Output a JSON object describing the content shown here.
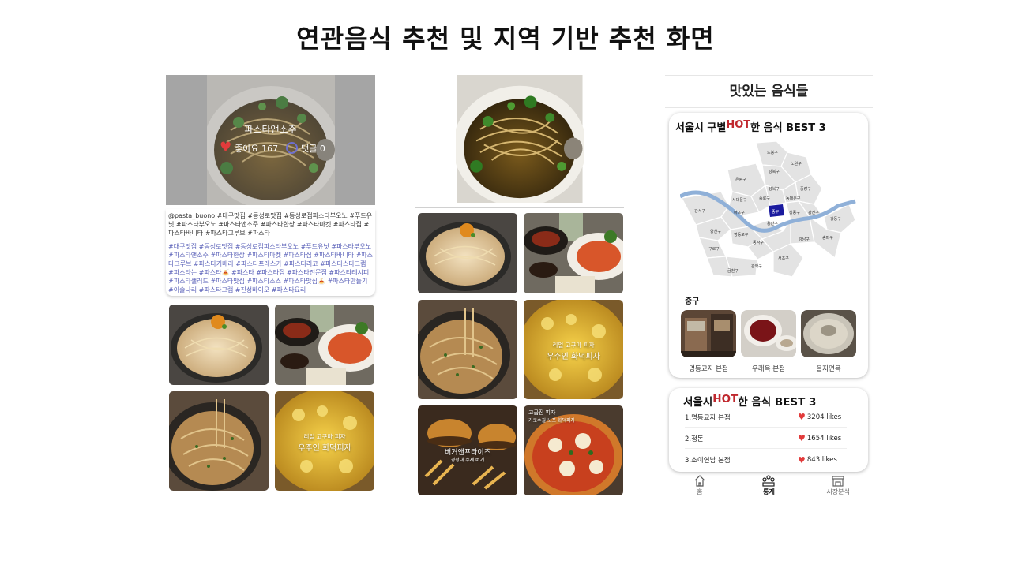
{
  "slide_title": "연관음식 추천 및 지역 기반 추천 화면",
  "panel1": {
    "hero": {
      "name": "파스타앤소주",
      "likes_text": "좋아요 167",
      "comments_text": "댓글 0"
    },
    "caption": "@pasta_buono #대구맛집 #동성로맛집 #동성로점파스타부오노 #푸드유닛 #파스타부오노 #파스타앤소주 #파스타한상 #파스타마켓 #파스타집 #파스타바니타 #파스타그루브 #파스타",
    "tags": "#대구맛집 #동성로맛집 #동성로점파스타부오노 #푸드유닛 #파스타부오노 #파스타앤소주 #파스타한상 #파스타마켓 #파스타집 #파스타바니타 #파스타그루브 #파스타거베라 #파스타프레스카 #파스타리코 #파스타스타그램 #파스타는 #파스타🍝 #파스타 #파스타집 #파스타전문점 #파스타레시피 #파스타샐러드 #파스타맛집 #파스타소스 #파스타맛집🍝 #파스타만들기 #이솔나리 #파스타그램 #진성바이오 #파스타요리",
    "pizza_line1": "리얼 고구마 피자",
    "pizza_line2": "우주인 화덕피자"
  },
  "panel2": {
    "pizza_line1": "리얼 고구마 피자",
    "pizza_line2": "우주인 화덕피자",
    "burger_line1": "버거앤프라이즈",
    "burger_line2": "경성대 수제 버거",
    "margherita_line1": "고급진 피자",
    "margherita_line2": "가로수길 노포 화덕피자"
  },
  "panel3": {
    "header": "맛있는 음식들",
    "card1": {
      "title_pre": "서울시 구별 ",
      "title_hot": "HOT",
      "title_post": "한 음식 BEST 3",
      "district": "중구",
      "map_labels": [
        "도봉구",
        "노원구",
        "강북구",
        "은평구",
        "성북구",
        "중랑구",
        "종로구",
        "서대문구",
        "동대문구",
        "마포구",
        "중구",
        "성동구",
        "광진구",
        "강서구",
        "용산구",
        "양천구",
        "영등포구",
        "동작구",
        "강동구",
        "구로구",
        "관악구",
        "서초구",
        "강남구",
        "송파구",
        "금천구"
      ],
      "shops": [
        "명동교자 본점",
        "우래옥 본점",
        "을지면옥"
      ]
    },
    "card2": {
      "title_pre": "서울시 ",
      "title_hot": "HOT",
      "title_post": "한 음식 BEST 3",
      "ranking": [
        {
          "name": "1.명동교자 본점",
          "likes": "3204 likes"
        },
        {
          "name": "2.정돈",
          "likes": "1654 likes"
        },
        {
          "name": "3.소이연남 본점",
          "likes": "843 likes"
        }
      ]
    },
    "nav": [
      {
        "label": "홈"
      },
      {
        "label": "통계"
      },
      {
        "label": "시장분석"
      }
    ],
    "colors": {
      "hot": "#c0282e",
      "selected_district": "#1a1a9e",
      "river": "#8fb0d8",
      "map_district": "#e3e3e3"
    }
  }
}
